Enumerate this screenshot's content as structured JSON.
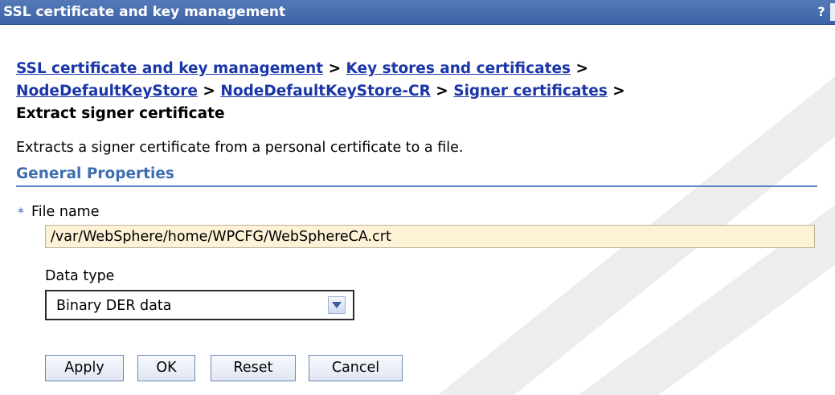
{
  "window": {
    "title": "SSL certificate and key management",
    "help_label": "?"
  },
  "breadcrumb": {
    "links": [
      "SSL certificate and key management",
      "Key stores and certificates",
      "NodeDefaultKeyStore",
      "NodeDefaultKeyStore-CR",
      "Signer certificates"
    ],
    "separator": ">",
    "current": "Extract signer certificate"
  },
  "description": "Extracts a signer certificate from a personal certificate to a file.",
  "section_title": "General Properties",
  "form": {
    "required_marker": "*",
    "file_name_label": "File name",
    "file_name_value": "/var/WebSphere/home/WPCFG/WebSphereCA.crt",
    "data_type_label": "Data type",
    "data_type_value": "Binary DER data"
  },
  "buttons": {
    "apply": "Apply",
    "ok": "OK",
    "reset": "Reset",
    "cancel": "Cancel"
  },
  "colors": {
    "title_bar": "#3d63a6",
    "link": "#1a36a8",
    "section_title": "#3e6eb0",
    "input_background": "#fdf2d6"
  }
}
